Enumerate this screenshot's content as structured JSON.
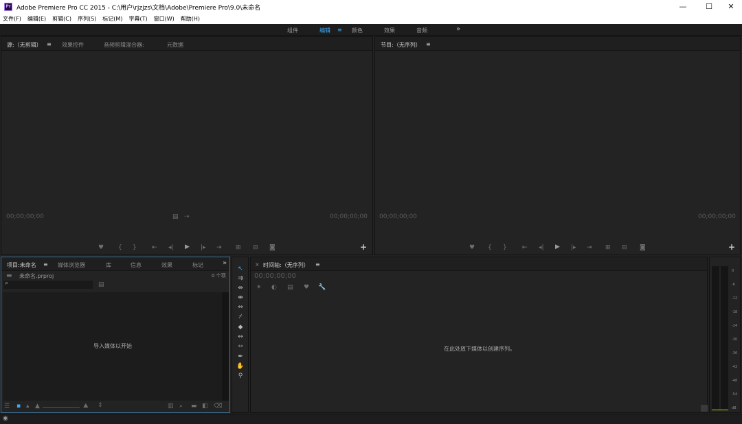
{
  "window": {
    "title": "Adobe Premiere Pro CC 2015 - C:\\用户\\rjzjzs\\文档\\Adobe\\Premiere Pro\\9.0\\未命名",
    "app_icon": "Pr",
    "minimize": "—",
    "maximize": "☐",
    "close": "✕"
  },
  "menu": [
    "文件(F)",
    "编辑(E)",
    "剪辑(C)",
    "序列(S)",
    "标记(M)",
    "字幕(T)",
    "窗口(W)",
    "帮助(H)"
  ],
  "workspaces": {
    "items": [
      "组件",
      "编辑",
      "颜色",
      "效果",
      "音频"
    ],
    "active": "编辑",
    "menu_icon": "≡",
    "overflow": "»"
  },
  "source_panel": {
    "tabs": [
      "源:（无剪辑）",
      "效果控件",
      "音频剪辑混合器:",
      "元数据"
    ],
    "menu_icon": "≡",
    "timecode_left": "00;00;00;00",
    "timecode_right": "00;00;00;00",
    "add": "+"
  },
  "program_panel": {
    "tab": "节目:（无序列）",
    "menu_icon": "≡",
    "timecode_left": "00;00;00;00",
    "timecode_right": "00;00;00;00",
    "add": "+"
  },
  "project_panel": {
    "tabs": [
      "项目:未命名",
      "媒体浏览器",
      "库",
      "信息",
      "效果",
      "标记"
    ],
    "menu_icon": "≡",
    "overflow": "»",
    "file_name": "未命名.prproj",
    "item_count": "0 个项",
    "empty_hint": "导入媒体以开始"
  },
  "timeline_panel": {
    "close": "×",
    "tab": "时间轴:（无序列）",
    "menu_icon": "≡",
    "timecode": "00;00;00;00",
    "empty_hint": "在此处放下媒体以创建序列。"
  },
  "audio_meter": {
    "ticks": [
      "0",
      "-6",
      "-12",
      "-18",
      "-24",
      "-30",
      "-36",
      "-42",
      "-48",
      "-54",
      "dB"
    ]
  },
  "colors": {
    "accent": "#3fa9f5",
    "panel_bg": "#232323",
    "meter_peak": "#c8c800"
  }
}
